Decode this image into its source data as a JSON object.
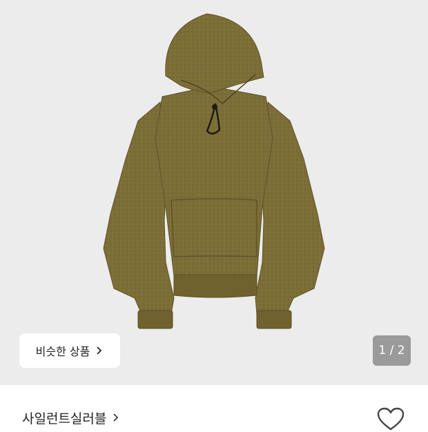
{
  "gallery": {
    "image_alt": "olive hoodie",
    "similar_button_label": "비슷한 상품",
    "page_indicator": "1 / 2",
    "product_color": "#7c6e37"
  },
  "product": {
    "brand_name": "사일런트실러블"
  },
  "icons": {
    "similar_chevron": "chevron-right-icon",
    "brand_chevron": "chevron-right-icon",
    "wishlist": "heart-outline-icon"
  }
}
